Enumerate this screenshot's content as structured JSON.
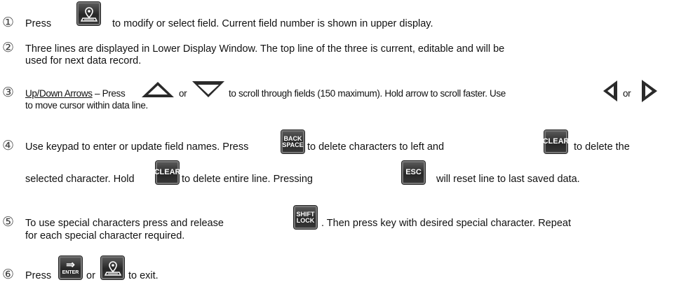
{
  "steps": [
    {
      "num": "①",
      "a": "Press",
      "b": "to modify or select field. Current field number is shown in upper display."
    },
    {
      "num": "②",
      "line1": "Three lines are displayed in Lower Display Window. The top line of the three is current, editable and will be",
      "line2": "used for next data record."
    },
    {
      "num": "③",
      "link": "Up/Down Arrows",
      "a": " – Press",
      "or1": "or",
      "b": "to scroll through fields (150 maximum). Hold arrow to scroll faster. Use",
      "or2": "or",
      "line2": "to move cursor within data line."
    },
    {
      "num": "④",
      "a": "Use keypad to enter or update field names. Press",
      "b": "to delete characters to left and",
      "c": "to delete the",
      "d": "selected character. Hold",
      "e": "to delete entire line. Pressing",
      "f": "will reset line to last saved data."
    },
    {
      "num": "⑤",
      "a": "To use special characters press and release",
      "b": ". Then press key with desired special character. Repeat",
      "line2": "for each special character required."
    },
    {
      "num": "⑥",
      "a": "Press",
      "or": "or",
      "b": "to exit."
    }
  ],
  "keys": {
    "back_space": [
      "BACK",
      "SPACE"
    ],
    "clear": "CLEAR",
    "esc": "ESC",
    "shift_lock": [
      "SHIFT",
      "LOCK"
    ],
    "enter": "ENTER",
    "enter_glyph": "⇒"
  },
  "icons": {
    "field": "field-map-icon",
    "up": "up-arrow-icon",
    "down": "down-arrow-icon",
    "left": "left-arrow-icon",
    "right": "right-arrow-icon"
  }
}
